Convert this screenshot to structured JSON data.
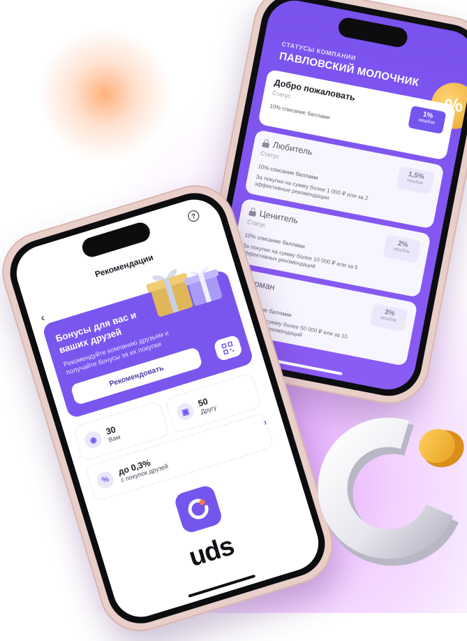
{
  "right_phone": {
    "subtitle": "СТАТУСЫ КОМПАНИИ",
    "company": "ПАВЛОВСКИЙ МОЛОЧНИК",
    "badge_symbol": "%",
    "statuses": [
      {
        "name": "Добро пожаловать",
        "status_label": "Статус",
        "writeoff": "10% списание баллами",
        "cashback": "1%",
        "cashback_label": "кешбэк",
        "condition": "",
        "active": true
      },
      {
        "name": "Любитель",
        "status_label": "Статус",
        "writeoff": "10% списание баллами",
        "cashback": "1,5%",
        "cashback_label": "кешбэк",
        "condition": "За покупки на сумму более 1 000 ₽ или за 2 эффективные рекомендации",
        "active": false
      },
      {
        "name": "Ценитель",
        "status_label": "Статус",
        "writeoff": "10% списание баллами",
        "cashback": "2%",
        "cashback_label": "кешбэк",
        "condition": "За покупки на сумму более 10 000 ₽ или за 5 эффективных рекомендаций",
        "active": false
      },
      {
        "name": "Гурман",
        "status_label": "Статус",
        "writeoff": "10% списание баллами",
        "cashback": "3%",
        "cashback_label": "кешбэк",
        "condition": "За покупки на сумму более 50 000 ₽ или за 10 эффективных рекомендаций",
        "active": false
      }
    ]
  },
  "left_phone": {
    "title": "Рекомендации",
    "help_symbol": "?",
    "promo": {
      "heading": "Бонусы для вас и ваших друзей",
      "description": "Рекомендуйте компанию друзьям и получайте бонусы за их покупки",
      "button": "Рекомендовать"
    },
    "stats": {
      "friend_value": "50",
      "friend_label": "Другу",
      "you_value": "30",
      "you_label": "Вам",
      "percent_value": "до 0,3%",
      "percent_label": "с покупок друзей"
    },
    "brand": "uds"
  },
  "colors": {
    "accent": "#7455ee",
    "coin": "#f0b43c"
  }
}
